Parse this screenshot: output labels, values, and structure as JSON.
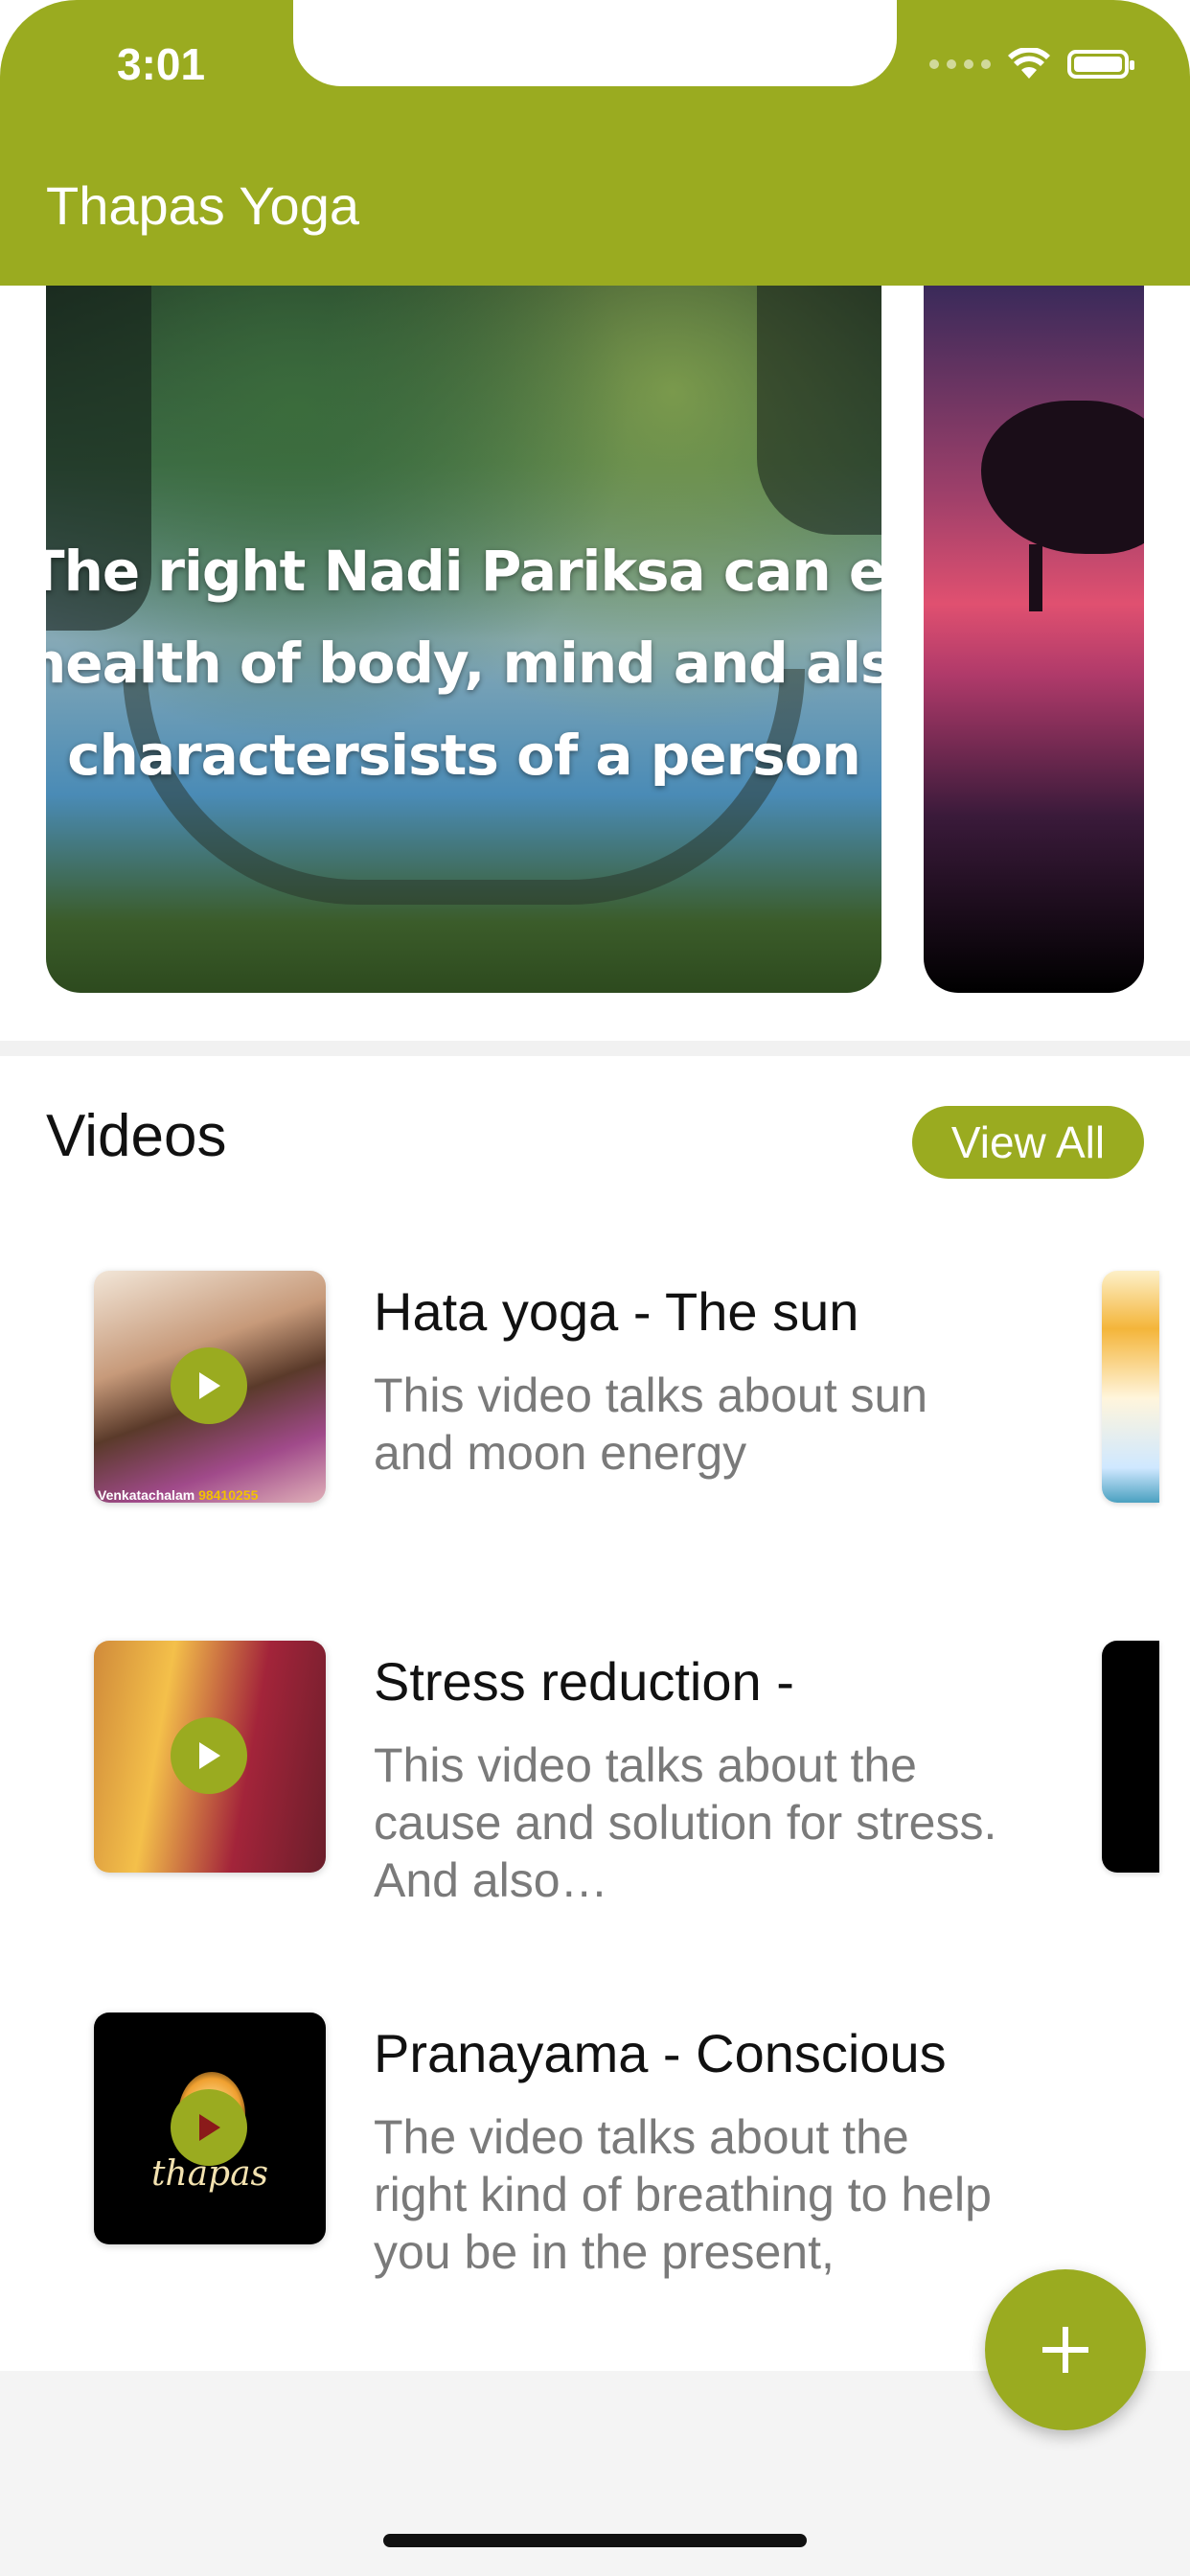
{
  "status_bar": {
    "time": "3:01"
  },
  "app_bar": {
    "title": "Thapas Yoga"
  },
  "carousel": {
    "slides": [
      {
        "quote_lines": [
          "The right Nadi Pariksa can explain the",
          "health of body, mind and also the",
          "charactersists of a person"
        ]
      },
      {
        "quote_lines": []
      }
    ]
  },
  "videos_section": {
    "title": "Videos",
    "view_all_label": "View All",
    "items": [
      {
        "title": "Hata yoga - The sun",
        "description": "This video talks about sun and moon energy",
        "thumb_caption": "Venkatachalam",
        "thumb_caption_number": "98410255"
      },
      {
        "title": "Stress reduction -",
        "description": "This video talks about the cause and solution for stress. And also…"
      },
      {
        "title": "Pranayama - Conscious",
        "description": "The video talks about the right kind of breathing to help you be in the present,",
        "thumb_word": "thapas"
      }
    ]
  },
  "fab": {
    "icon": "plus-icon"
  },
  "colors": {
    "accent": "#9aab20"
  }
}
